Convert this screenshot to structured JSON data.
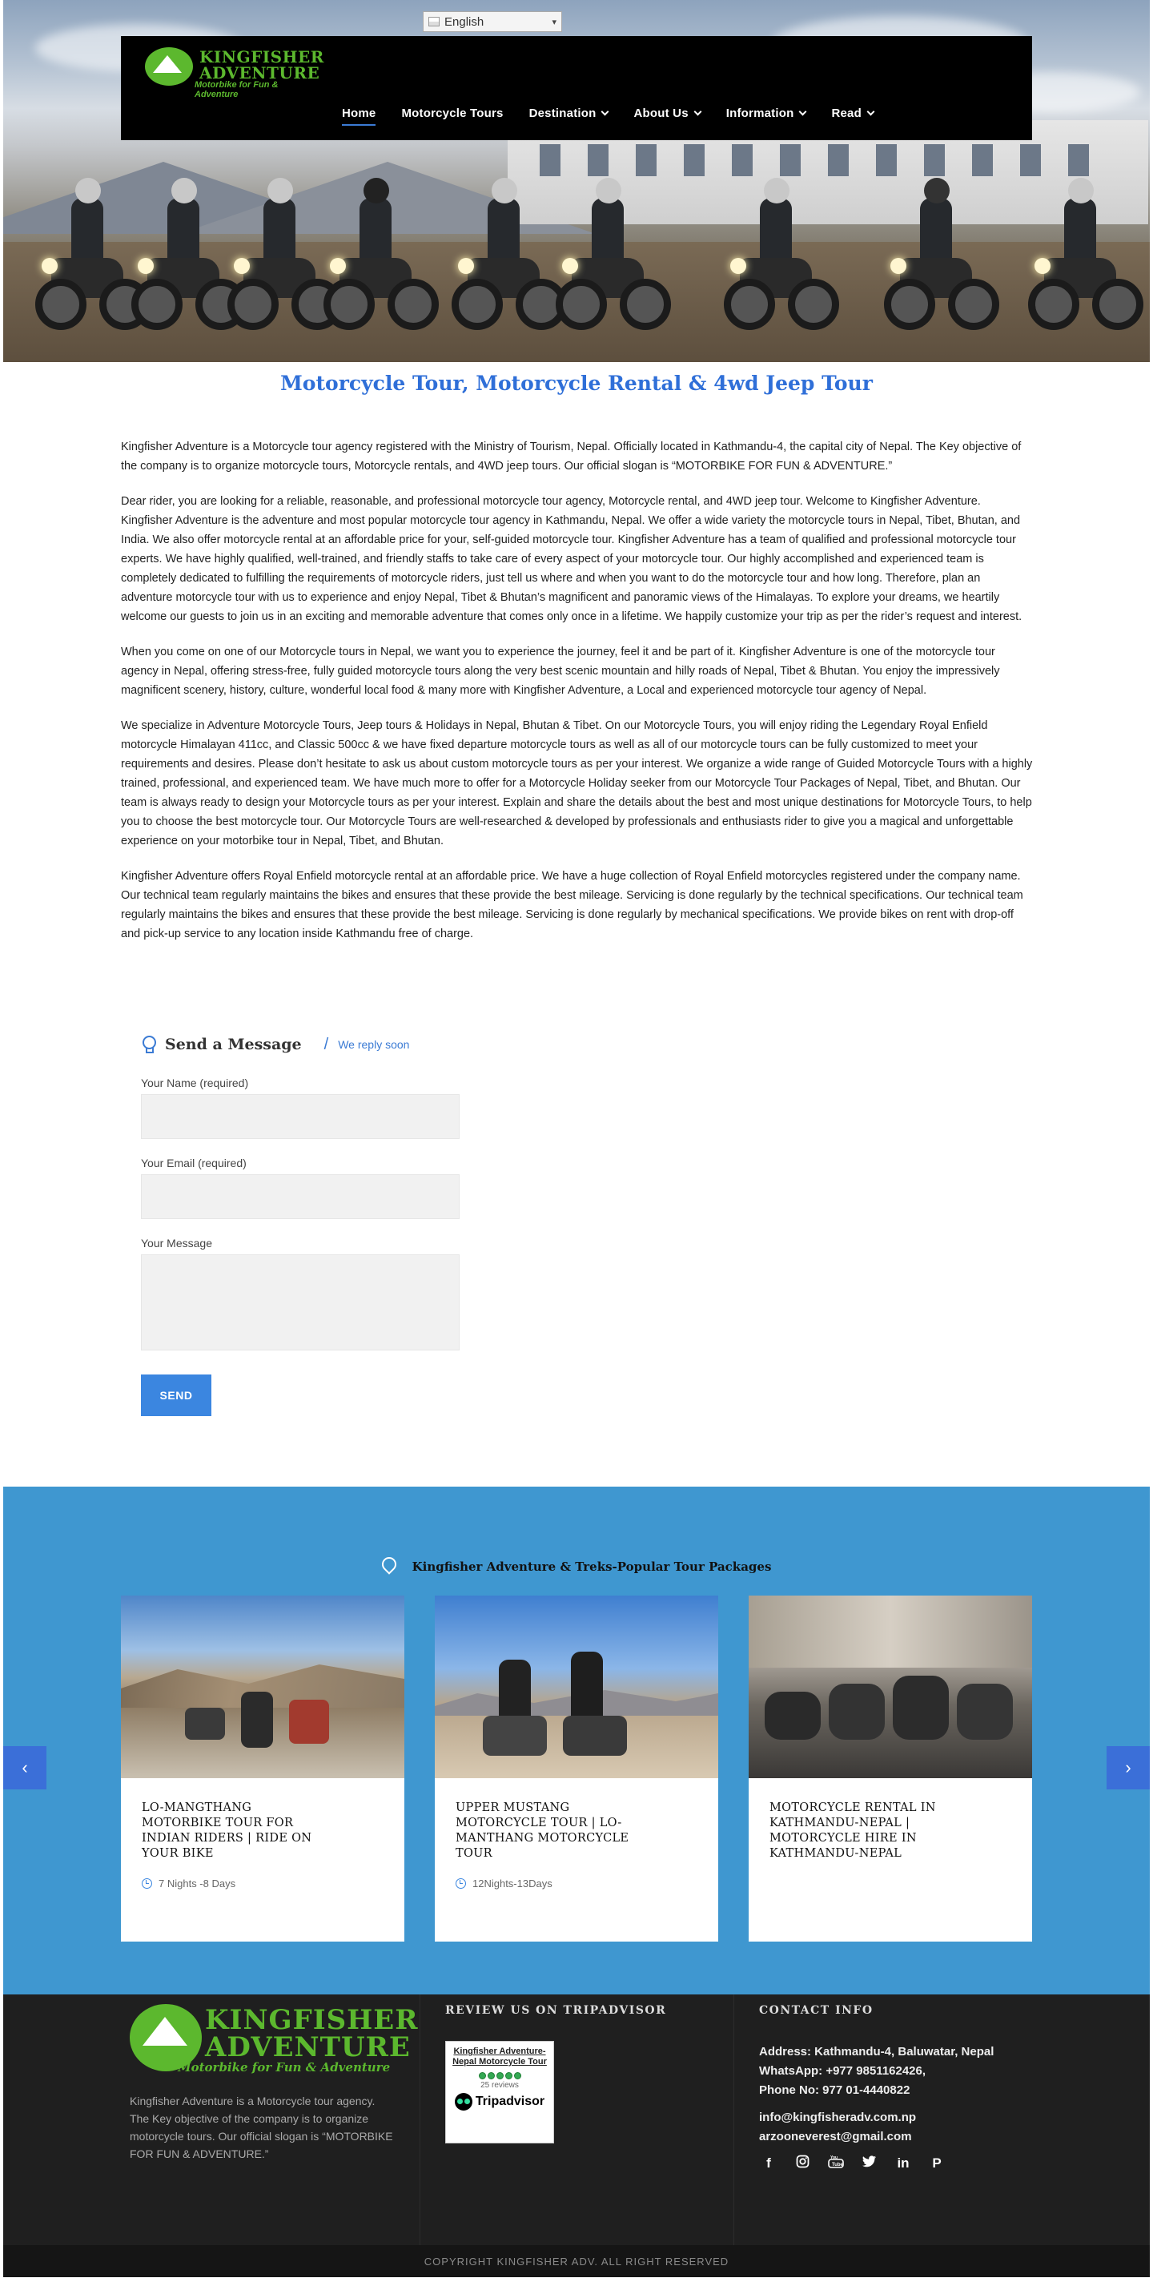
{
  "language_selector": {
    "value": "English",
    "flag_alt": "en"
  },
  "brand": {
    "line1": "KINGFISHER",
    "line2": "ADVENTURE",
    "tagline": "Motorbike for Fun & Adventure"
  },
  "nav": {
    "items": [
      {
        "label": "Home",
        "active": true,
        "dropdown": false
      },
      {
        "label": "Motorcycle Tours",
        "active": false,
        "dropdown": false
      },
      {
        "label": "Destination",
        "active": false,
        "dropdown": true
      },
      {
        "label": "About Us",
        "active": false,
        "dropdown": true
      },
      {
        "label": "Information",
        "active": false,
        "dropdown": true
      },
      {
        "label": "Read",
        "active": false,
        "dropdown": true
      }
    ]
  },
  "intro": {
    "headline": "Motorcycle Tour,  Motorcycle Rental & 4wd Jeep Tour",
    "paragraphs": [
      "Kingfisher Adventure is a Motorcycle tour agency registered with the Ministry of Tourism, Nepal. Officially located in Kathmandu-4, the capital city of Nepal. The Key objective of the company is to organize motorcycle tours, Motorcycle rentals, and 4WD jeep tours. Our official slogan is “MOTORBIKE FOR FUN & ADVENTURE.”",
      "Dear rider, you are looking for a reliable, reasonable, and professional motorcycle tour agency, Motorcycle rental, and 4WD jeep tour. Welcome to Kingfisher Adventure. Kingfisher Adventure is the adventure and most popular motorcycle tour agency in Kathmandu, Nepal. We offer a wide variety the motorcycle tours in Nepal, Tibet, Bhutan, and India. We also offer motorcycle rental at an affordable price for your, self-guided motorcycle tour. Kingfisher Adventure has a team of qualified and professional motorcycle tour experts. We have highly qualified, well-trained, and friendly staffs to take care of every aspect of your motorcycle tour. Our highly accomplished and experienced team is completely dedicated to fulfilling the requirements of motorcycle riders, just tell us where and when you want to do the motorcycle tour and how long. Therefore, plan an adventure motorcycle tour with us to experience and enjoy Nepal, Tibet & Bhutan’s magnificent and panoramic views of the Himalayas. To explore your dreams, we heartily welcome our guests to join us in an exciting and memorable adventure that comes only once in a lifetime. We happily customize your trip as per the rider’s request and interest.",
      "When you come on one of our Motorcycle tours in Nepal, we want you to experience the journey, feel it and be part of it. Kingfisher Adventure is one of the motorcycle tour agency in Nepal, offering stress-free, fully guided motorcycle tours along the very best scenic mountain and hilly roads of Nepal, Tibet & Bhutan. You enjoy the impressively magnificent scenery, history, culture, wonderful local food & many more with Kingfisher Adventure, a Local and experienced motorcycle tour agency of Nepal.",
      "We specialize in Adventure Motorcycle Tours, Jeep tours & Holidays in Nepal, Bhutan & Tibet. On our Motorcycle Tours, you will enjoy riding the Legendary Royal Enfield motorcycle Himalayan 411cc, and Classic 500cc & we have fixed departure motorcycle tours as well as all of our motorcycle tours can be fully customized to meet your requirements and desires. Please don’t hesitate to ask us about custom motorcycle tours as per your interest. We organize a wide range of Guided Motorcycle Tours with a highly trained, professional, and experienced team. We have much more to offer for a Motorcycle Holiday seeker from our Motorcycle Tour Packages of Nepal, Tibet, and Bhutan. Our team is always ready to design your Motorcycle tours as per your interest. Explain and share the details about the best and most unique destinations for Motorcycle Tours, to help you to choose the best motorcycle tour. Our Motorcycle Tours are well-researched & developed by professionals and enthusiasts rider to give you a magical and unforgettable experience on your motorbike tour in Nepal, Tibet, and Bhutan.",
      "Kingfisher Adventure offers Royal Enfield motorcycle rental at an affordable price.  We have a huge collection of Royal Enfield motorcycles registered under the company name. Our technical team regularly maintains the bikes and ensures that these provide the best mileage. Servicing is done regularly by the technical specifications. Our technical team regularly maintains the bikes and ensures that these provide the best mileage. Servicing is done regularly by mechanical specifications.  We provide bikes on rent with drop-off and pick-up service to any location inside Kathmandu free of charge."
    ]
  },
  "contact_form": {
    "title": "Send a Message",
    "separator": "/",
    "subtitle": "We reply soon",
    "name_label": "Your Name (required)",
    "email_label": "Your Email (required)",
    "message_label": "Your Message",
    "submit_label": "SEND"
  },
  "packages": {
    "title": "Kingfisher Adventure & Treks-Popular Tour Packages",
    "prev_label": "‹",
    "next_label": "›",
    "cards": [
      {
        "title": "LO-MANGTHANG MOTORBIKE TOUR FOR INDIAN RIDERS | RIDE ON YOUR BIKE",
        "duration": "7 Nights -8 Days"
      },
      {
        "title": "UPPER MUSTANG MOTORCYCLE TOUR | LO-MANTHANG MOTORCYCLE TOUR",
        "duration": "12Nights-13Days"
      },
      {
        "title": "MOTORCYCLE RENTAL IN KATHMANDU-NEPAL | MOTORCYCLE HIRE IN KATHMANDU-NEPAL",
        "duration": ""
      }
    ]
  },
  "footer": {
    "about": "Kingfisher Adventure is a Motorcycle tour agency. The Key objective of the company is to organize motorcycle tours. Our official slogan is “MOTORBIKE FOR FUN & ADVENTURE.”",
    "review_heading": "REVIEW US ON TRIPADVISOR",
    "tripadvisor": {
      "name": "Kingfisher Adventure-Nepal Motorcycle Tour",
      "reviews": "25 reviews",
      "brand": "Tripadvisor"
    },
    "contact_heading": "CONTACT INFO",
    "address": "Address: Kathmandu-4, Baluwatar, Nepal",
    "whatsapp": "WhatsApp: +977 9851162426,",
    "phone": "Phone No: 977 01-4440822",
    "email1": "info@kingfisheradv.com.np",
    "email2": "arzooneverest@gmail.com",
    "social": [
      "facebook-icon",
      "instagram-icon",
      "youtube-icon",
      "twitter-icon",
      "linkedin-icon",
      "pinterest-icon"
    ],
    "copyright": "COPYRIGHT KINGFISHER ADV. ALL RIGHT RESERVED"
  },
  "colors": {
    "accent": "#3b7bd4",
    "brand_green": "#5cb82e",
    "packages_bg": "#3f97d0",
    "footer_bg": "#1f1f1f"
  }
}
